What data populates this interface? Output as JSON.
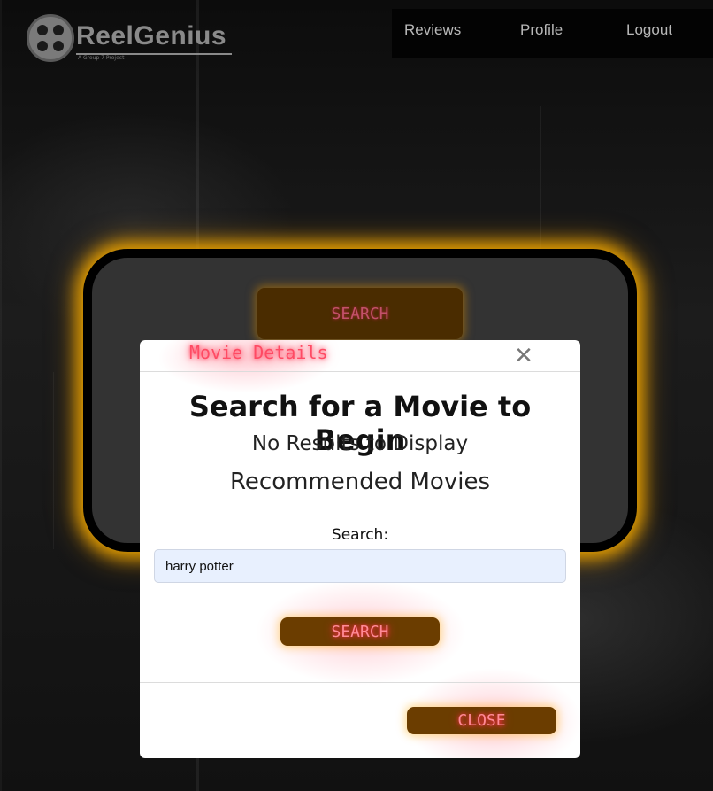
{
  "app": {
    "name": "ReelGenius",
    "tagline": "A Group 7 Project"
  },
  "nav": {
    "items": [
      {
        "label": "Reviews"
      },
      {
        "label": "Profile"
      },
      {
        "label": "Logout"
      }
    ]
  },
  "background_panel": {
    "search_label": "SEARCH"
  },
  "modal": {
    "title": "Movie Details",
    "close_icon": "close-icon",
    "heading": "Search for a Movie to Begin",
    "no_results": "No Results to Display",
    "recommended": "Recommended Movies",
    "search_label": "Search:",
    "search_value": "harry potter",
    "search_button": "SEARCH",
    "close_button": "CLOSE"
  },
  "colors": {
    "neon_text": "#ff4a63",
    "button_bg": "#6b3d00",
    "panel_glow": "#e6a000",
    "input_bg": "#e8f0fe"
  }
}
